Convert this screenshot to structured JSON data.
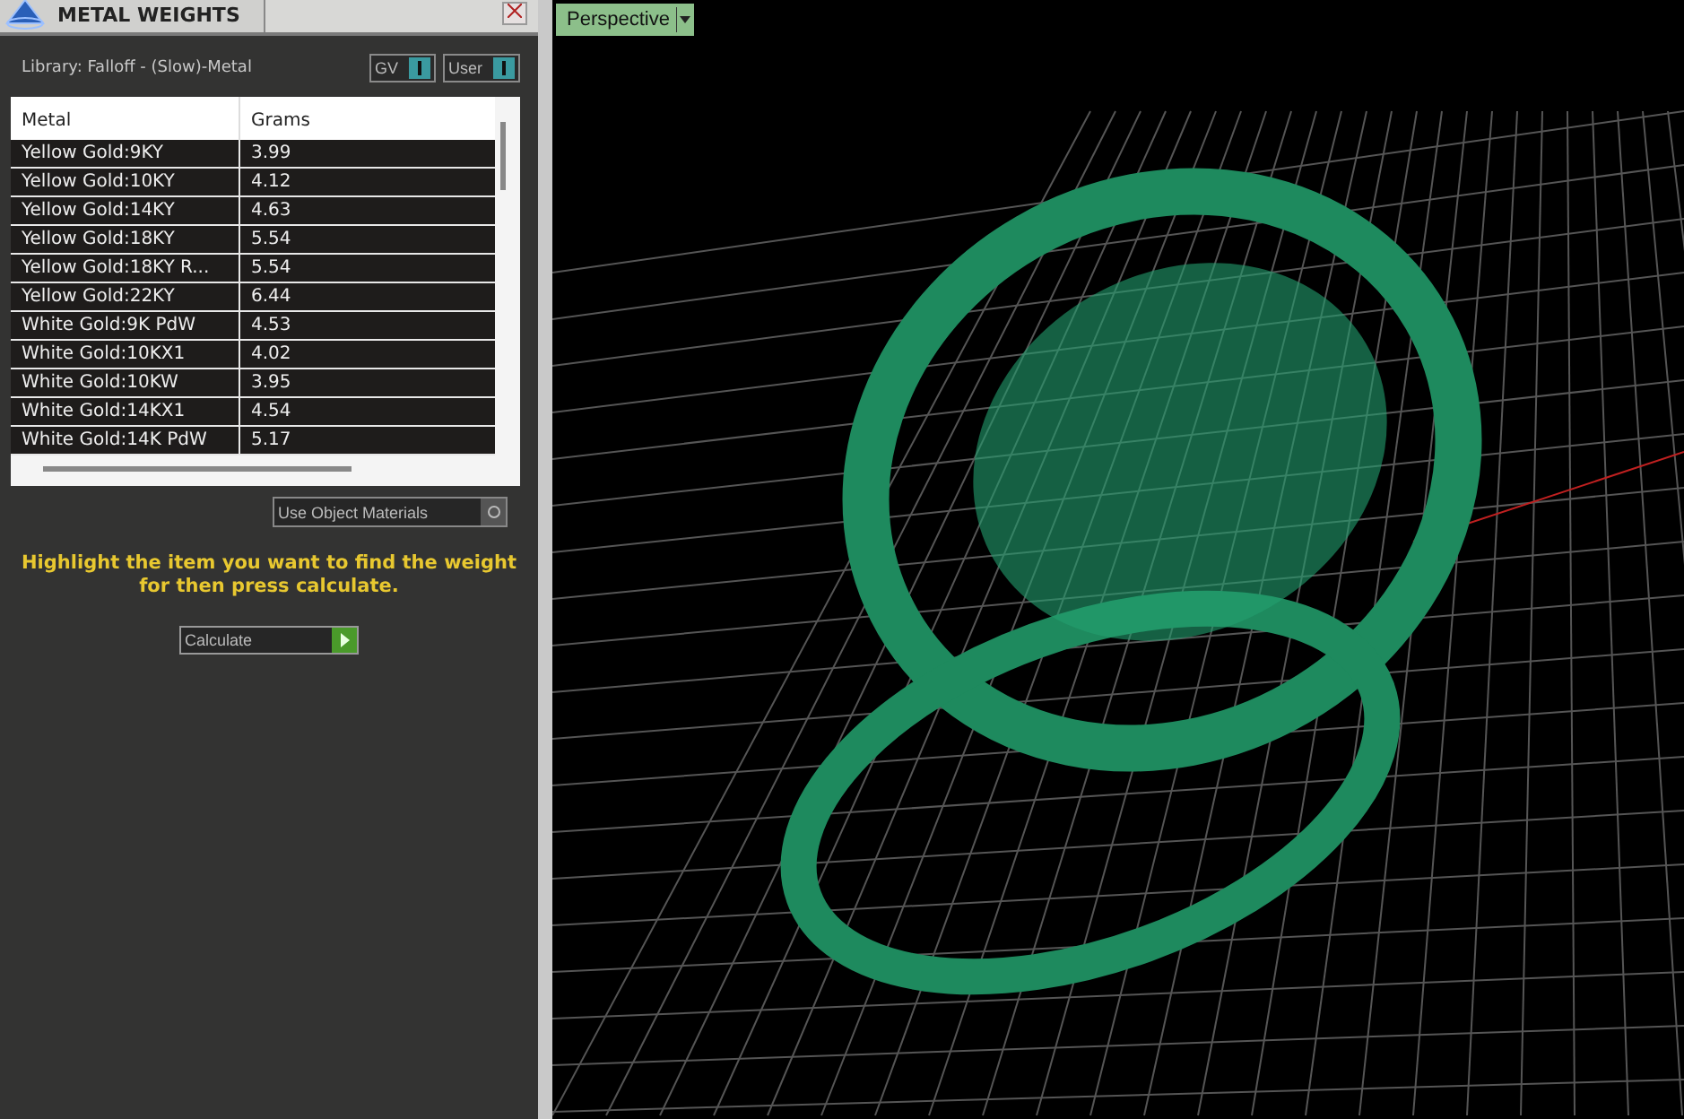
{
  "panel": {
    "title": "METAL WEIGHTS",
    "library": "Library: Falloff - (Slow)-Metal",
    "toggles": [
      {
        "label": "GV",
        "on": true
      },
      {
        "label": "User",
        "on": true
      }
    ],
    "table": {
      "columns": [
        "Metal",
        "Grams"
      ],
      "rows": [
        {
          "metal": "Yellow Gold:9KY",
          "grams": "3.99"
        },
        {
          "metal": "Yellow Gold:10KY",
          "grams": "4.12"
        },
        {
          "metal": "Yellow Gold:14KY",
          "grams": "4.63"
        },
        {
          "metal": "Yellow Gold:18KY",
          "grams": "5.54"
        },
        {
          "metal": "Yellow Gold:18KY R...",
          "grams": "5.54"
        },
        {
          "metal": "Yellow Gold:22KY",
          "grams": "6.44"
        },
        {
          "metal": "White Gold:9K PdW",
          "grams": "4.53"
        },
        {
          "metal": "White Gold:10KX1",
          "grams": "4.02"
        },
        {
          "metal": "White Gold:10KW",
          "grams": "3.95"
        },
        {
          "metal": "White Gold:14KX1",
          "grams": "4.54"
        },
        {
          "metal": "White Gold:14K PdW",
          "grams": "5.17"
        }
      ]
    },
    "use_object_materials": {
      "label": "Use Object Materials",
      "checked": false
    },
    "hint": "Highlight the item you want to find the weight for then press calculate.",
    "calculate": "Calculate"
  },
  "viewport": {
    "view": "Perspective"
  }
}
